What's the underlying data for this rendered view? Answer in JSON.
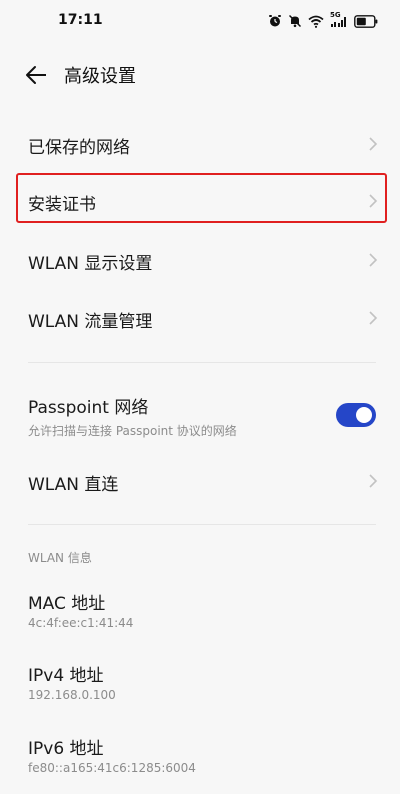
{
  "status_bar": {
    "time": "17:11",
    "network_label": "5G",
    "icons": [
      "alarm-icon",
      "mute-icon",
      "wifi-icon",
      "cellular-signal-icon",
      "battery-icon"
    ]
  },
  "header": {
    "title": "高级设置",
    "back_icon": "arrow-left-icon"
  },
  "menu": {
    "saved_networks": "已保存的网络",
    "install_certificates": "安装证书",
    "wlan_display_settings": "WLAN 显示设置",
    "wlan_data_management": "WLAN 流量管理"
  },
  "passpoint": {
    "title": "Passpoint 网络",
    "subtitle": "允许扫描与连接 Passpoint 协议的网络",
    "enabled": true
  },
  "wlan_direct": "WLAN 直连",
  "wlan_info": {
    "section_title": "WLAN 信息",
    "mac_label": "MAC 地址",
    "mac_value": "4c:4f:ee:c1:41:44",
    "ipv4_label": "IPv4 地址",
    "ipv4_value": "192.168.0.100",
    "ipv6_label": "IPv6 地址",
    "ipv6_value": "fe80::a165:41c6:1285:6004"
  },
  "colors": {
    "accent": "#2546c8",
    "highlight_border": "#e02020",
    "background": "#f7f7f7"
  }
}
